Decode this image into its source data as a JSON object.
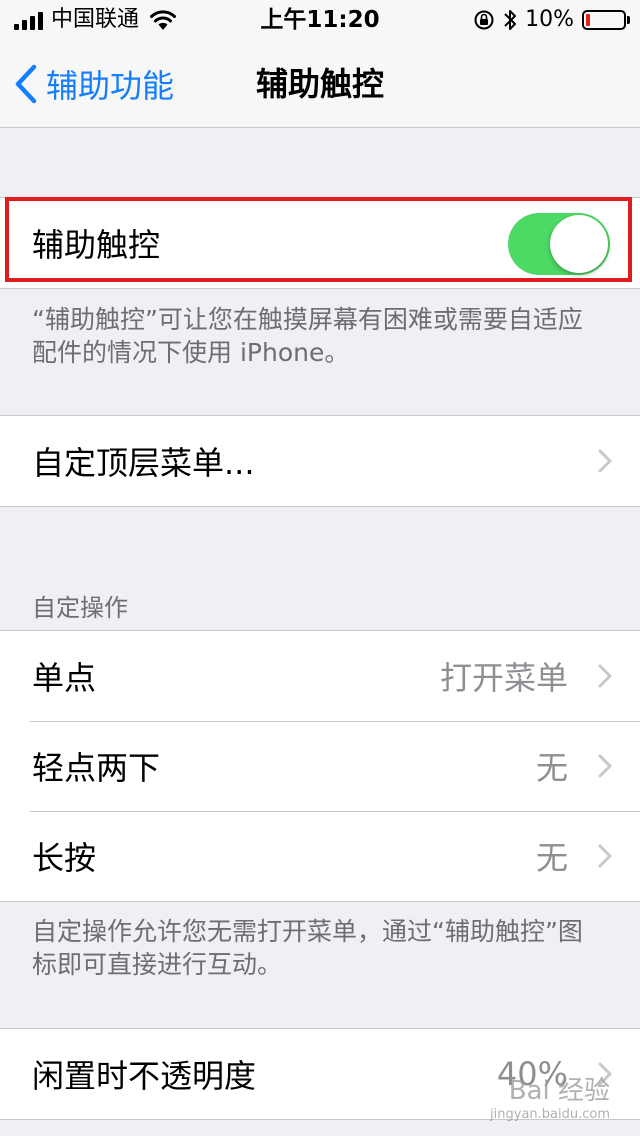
{
  "status_bar": {
    "carrier": "中国联通",
    "time": "上午11:20",
    "battery_percent": "10%",
    "battery_level": 0.1,
    "battery_color": "#e51e1e"
  },
  "nav": {
    "back_label": "辅助功能",
    "title": "辅助触控"
  },
  "assistive_touch": {
    "label": "辅助触控",
    "enabled": true,
    "toggle_color": "#4cd964",
    "footer": "“辅助触控”可让您在触摸屏幕有困难或需要自适应配件的情况下使用 iPhone。"
  },
  "top_menu": {
    "label": "自定顶层菜单..."
  },
  "custom_actions": {
    "header": "自定操作",
    "rows": [
      {
        "label": "单点",
        "value": "打开菜单"
      },
      {
        "label": "轻点两下",
        "value": "无"
      },
      {
        "label": "长按",
        "value": "无"
      }
    ],
    "footer": "自定操作允许您无需打开菜单，通过“辅助触控”图标即可直接进行互动。"
  },
  "idle_opacity": {
    "label": "闲置时不透明度",
    "value": "40%"
  },
  "watermark": {
    "brand": "Bai 经验",
    "url": "jingyan.baidu.com"
  },
  "accent_color": "#157efb",
  "highlight_color": "#e21c1c"
}
